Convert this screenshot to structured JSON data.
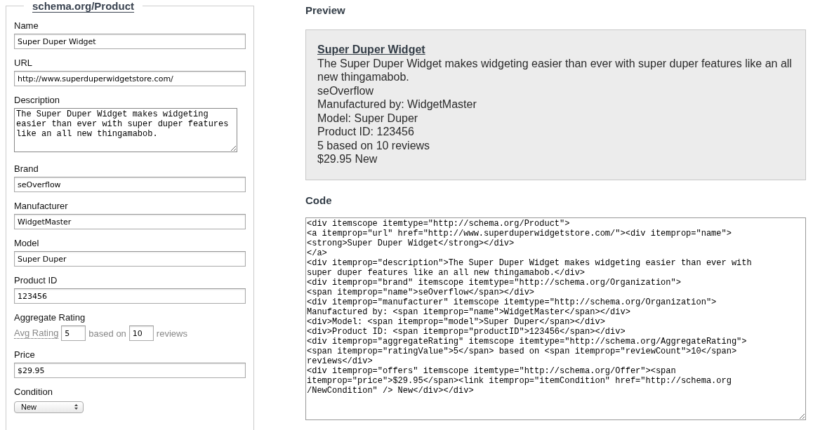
{
  "form": {
    "legend": "schema.org/Product",
    "fields": [
      {
        "kind": "text",
        "label": "Name",
        "value": "Super Duper Widget"
      },
      {
        "kind": "text",
        "label": "URL",
        "value": "http://www.superduperwidgetstore.com/"
      },
      {
        "kind": "textarea",
        "label": "Description",
        "value": "The Super Duper Widget makes widgeting easier than ever with super duper features like an all new thingamabob."
      },
      {
        "kind": "text",
        "label": "Brand",
        "value": "seOverflow"
      },
      {
        "kind": "text",
        "label": "Manufacturer",
        "value": "WidgetMaster"
      },
      {
        "kind": "text",
        "label": "Model",
        "value": "Super Duper"
      },
      {
        "kind": "text",
        "label": "Product ID",
        "value": "123456"
      },
      {
        "kind": "rating",
        "label": "Aggregate Rating",
        "rating_label": "Avg Rating",
        "rating_value": "5",
        "between": "based on",
        "count_value": "10",
        "after": "reviews"
      },
      {
        "kind": "text",
        "label": "Price",
        "value": "$29.95"
      },
      {
        "kind": "select",
        "label": "Condition",
        "value": "New"
      }
    ]
  },
  "preview": {
    "heading": "Preview",
    "title": "Super Duper Widget",
    "lines": [
      "The Super Duper Widget makes widgeting easier than ever with super duper features like an all new thingamabob.",
      "seOverflow",
      "Manufactured by: WidgetMaster",
      "Model: Super Duper",
      "Product ID: 123456",
      "5 based on 10 reviews",
      "$29.95 New"
    ]
  },
  "code": {
    "heading": "Code",
    "lines": [
      "<div itemscope itemtype=\"http://schema.org/Product\">",
      "<a itemprop=\"url\" href=\"http://www.superduperwidgetstore.com/\"><div itemprop=\"name\">",
      "<strong>Super Duper Widget</strong></div>",
      "</a>",
      "<div itemprop=\"description\">The Super Duper Widget makes widgeting easier than ever with",
      "super duper features like an all new thingamabob.</div>",
      "<div itemprop=\"brand\" itemscope itemtype=\"http://schema.org/Organization\">",
      "<span itemprop=\"name\">seOverflow</span></div>",
      "<div itemprop=\"manufacturer\" itemscope itemtype=\"http://schema.org/Organization\">",
      "Manufactured by: <span itemprop=\"name\">WidgetMaster</span></div>",
      "<div>Model: <span itemprop=\"model\">Super Duper</span></div>",
      "<div>Product ID: <span itemprop=\"productID\">123456</span></div>",
      "<div itemprop=\"aggregateRating\" itemscope itemtype=\"http://schema.org/AggregateRating\">",
      "<span itemprop=\"ratingValue\">5</span> based on <span itemprop=\"reviewCount\">10</span>",
      "reviews</div>",
      "<div itemprop=\"offers\" itemscope itemtype=\"http://schema.org/Offer\"><span",
      "itemprop=\"price\">$29.95</span><link itemprop=\"itemCondition\" href=\"http://schema.org",
      "/NewCondition\" /> New</div></div>"
    ]
  }
}
